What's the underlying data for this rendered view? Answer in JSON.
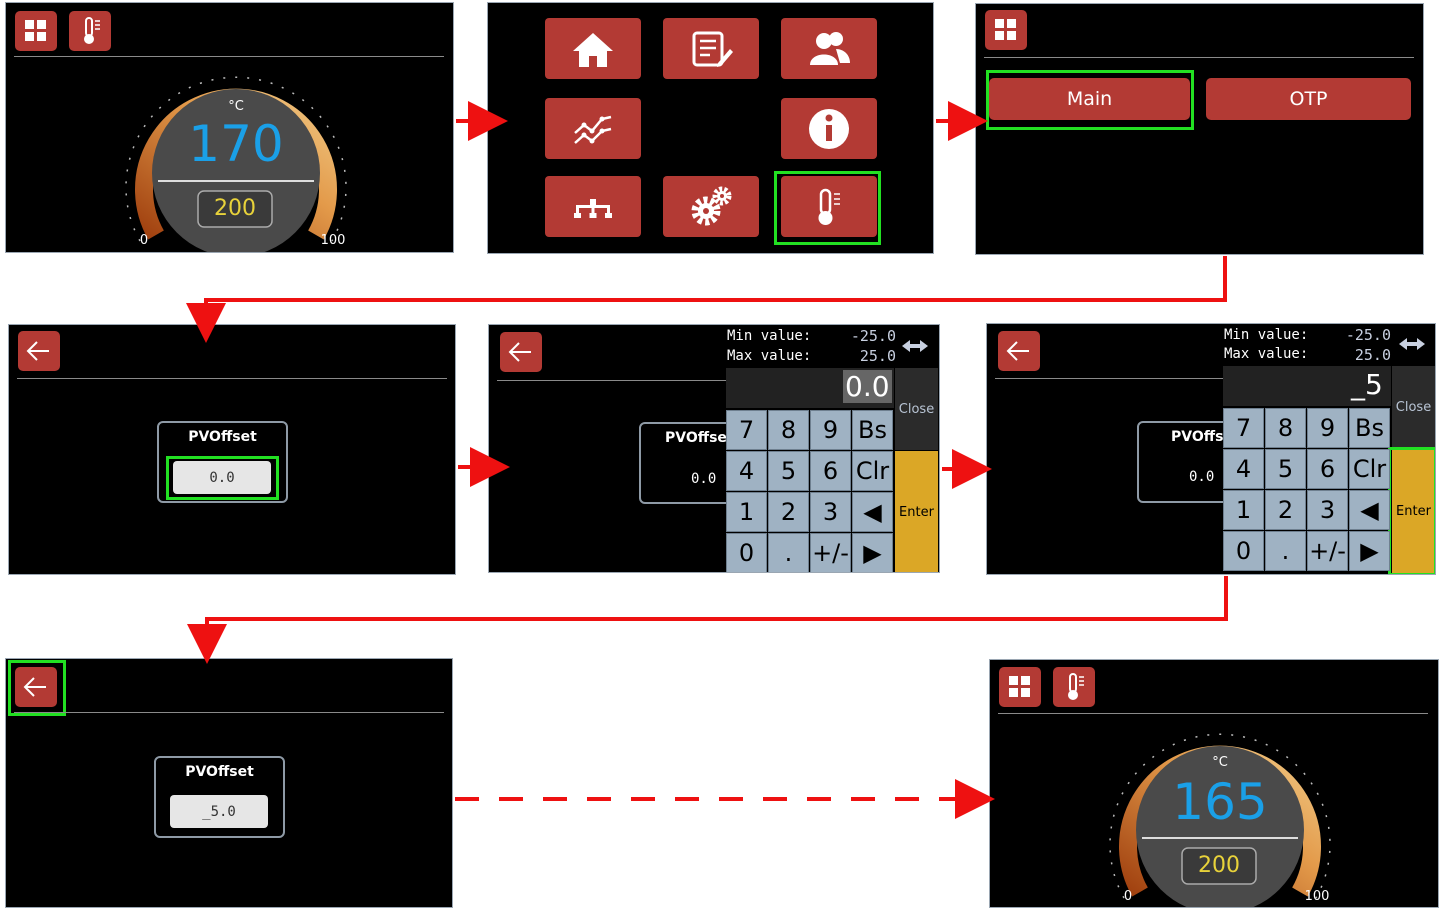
{
  "step1": {
    "unit": "°C",
    "pv": "170",
    "sp": "200",
    "min": "0",
    "max": "100"
  },
  "step2": {
    "tiles": [
      "home-icon",
      "report-icon",
      "users-icon",
      "trend-icon",
      "info-icon",
      "network-icon",
      "settings-icon",
      "thermometer-icon"
    ]
  },
  "step3": {
    "main_label": "Main",
    "otp_label": "OTP"
  },
  "step4": {
    "field_label": "PVOffset",
    "value": "0.0"
  },
  "step5": {
    "field_label": "PVOffse",
    "value": "0.0",
    "min_label": "Min value:",
    "min_value": "-25.0",
    "max_label": "Max value:",
    "max_value": "25.0",
    "display": "0.0",
    "close": "Close",
    "enter": "Enter"
  },
  "step6": {
    "field_label": "PVOffse",
    "value": "0.0",
    "min_label": "Min value:",
    "min_value": "-25.0",
    "max_label": "Max value:",
    "max_value": "25.0",
    "display": "_5",
    "close": "Close",
    "enter": "Enter"
  },
  "step7": {
    "field_label": "PVOffset",
    "value": "_5.0"
  },
  "step8": {
    "unit": "°C",
    "pv": "165",
    "sp": "200",
    "min": "0",
    "max": "100"
  },
  "keypad_keys": [
    "7",
    "8",
    "9",
    "Bs",
    "4",
    "5",
    "6",
    "Clr",
    "1",
    "2",
    "3",
    "◀",
    "0",
    ".",
    "+/-",
    "▶"
  ],
  "colors": {
    "accent_red": "#b33a34",
    "highlight": "#22e022",
    "pv_blue": "#1aa0e8",
    "sp_yellow": "#e8d23a",
    "enter_yellow": "#dba726",
    "arrow_red": "#ee1111"
  }
}
